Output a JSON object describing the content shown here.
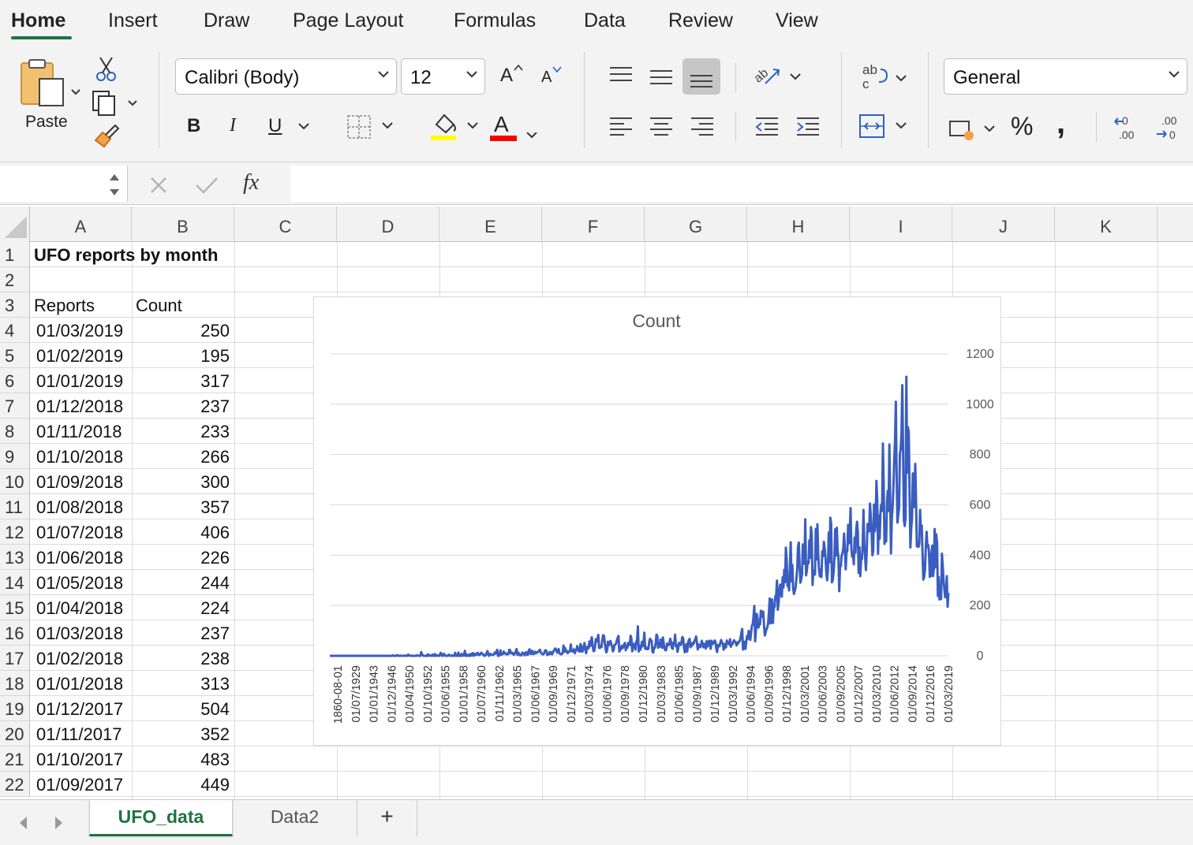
{
  "ribbon_tabs": [
    "Home",
    "Insert",
    "Draw",
    "Page Layout",
    "Formulas",
    "Data",
    "Review",
    "View"
  ],
  "active_tab": "Home",
  "ribbon": {
    "paste_label": "Paste",
    "font_name": "Calibri (Body)",
    "font_size": "12",
    "bold_label": "B",
    "italic_label": "I",
    "underline_label": "U",
    "font_color_label": "A",
    "number_format": "General",
    "percent_label": "%",
    "comma_label": ",",
    "increase_font_label": "A",
    "decrease_font_label": "A",
    "fill_color": "#ffff00",
    "font_color": "#ff0000"
  },
  "formula_bar": {
    "fx_label": "fx",
    "name_box": "",
    "formula": ""
  },
  "columns": [
    "A",
    "B",
    "C",
    "D",
    "E",
    "F",
    "G",
    "H",
    "I",
    "J",
    "K"
  ],
  "rows": [
    "1",
    "2",
    "3",
    "4",
    "5",
    "6",
    "7",
    "8",
    "9",
    "10",
    "11",
    "12",
    "13",
    "14",
    "15",
    "16",
    "17",
    "18",
    "19",
    "20",
    "21",
    "22"
  ],
  "sheet": {
    "title": "UFO reports by month",
    "header_reports": "Reports",
    "header_count": "Count",
    "data": [
      {
        "date": "01/03/2019",
        "count": "250"
      },
      {
        "date": "01/02/2019",
        "count": "195"
      },
      {
        "date": "01/01/2019",
        "count": "317"
      },
      {
        "date": "01/12/2018",
        "count": "237"
      },
      {
        "date": "01/11/2018",
        "count": "233"
      },
      {
        "date": "01/10/2018",
        "count": "266"
      },
      {
        "date": "01/09/2018",
        "count": "300"
      },
      {
        "date": "01/08/2018",
        "count": "357"
      },
      {
        "date": "01/07/2018",
        "count": "406"
      },
      {
        "date": "01/06/2018",
        "count": "226"
      },
      {
        "date": "01/05/2018",
        "count": "244"
      },
      {
        "date": "01/04/2018",
        "count": "224"
      },
      {
        "date": "01/03/2018",
        "count": "237"
      },
      {
        "date": "01/02/2018",
        "count": "238"
      },
      {
        "date": "01/01/2018",
        "count": "313"
      },
      {
        "date": "01/12/2017",
        "count": "504"
      },
      {
        "date": "01/11/2017",
        "count": "352"
      },
      {
        "date": "01/10/2017",
        "count": "483"
      },
      {
        "date": "01/09/2017",
        "count": "449"
      }
    ]
  },
  "chart_data": {
    "type": "line",
    "title": "Count",
    "xlabel": "",
    "ylabel": "",
    "ylim": [
      0,
      1200
    ],
    "yticks": [
      0,
      200,
      400,
      600,
      800,
      1000,
      1200
    ],
    "y_axis_side": "right",
    "grid": true,
    "legend": "none",
    "series_color": "#3a5dbf",
    "x_tick_labels": [
      "1860-08-01",
      "01/07/1929",
      "01/01/1943",
      "01/12/1946",
      "01/04/1950",
      "01/10/1952",
      "01/06/1955",
      "01/01/1958",
      "01/07/1960",
      "01/11/1962",
      "01/03/1965",
      "01/06/1967",
      "01/09/1969",
      "01/12/1971",
      "01/03/1974",
      "01/06/1976",
      "01/09/1978",
      "01/12/1980",
      "01/03/1983",
      "01/06/1985",
      "01/09/1987",
      "01/12/1989",
      "01/03/1992",
      "01/06/1994",
      "01/09/1996",
      "01/12/1998",
      "01/03/2001",
      "01/06/2003",
      "01/09/2005",
      "01/12/2007",
      "01/03/2010",
      "01/06/2012",
      "01/09/2014",
      "01/12/2016",
      "01/03/2019"
    ],
    "series": [
      {
        "values": [
          0,
          0,
          0,
          0,
          0,
          0,
          0,
          0,
          0,
          0,
          0,
          0,
          0,
          0,
          0,
          0,
          0,
          0,
          0,
          0,
          0,
          0,
          0,
          0,
          0,
          0,
          0,
          0,
          0,
          0,
          0,
          0,
          0,
          0,
          0,
          0,
          0,
          0,
          0,
          0,
          0,
          0,
          0,
          0,
          0,
          0,
          0,
          0,
          0,
          0,
          0,
          0,
          0,
          0,
          0,
          0,
          0,
          0,
          0,
          0,
          0,
          0,
          0,
          0,
          0,
          0,
          0,
          0,
          0,
          0,
          0,
          0,
          0,
          0,
          0,
          0,
          0,
          0,
          2,
          0,
          0,
          0,
          0,
          3,
          1,
          0,
          0,
          1,
          0,
          0,
          0,
          0,
          0,
          1,
          0,
          1,
          0,
          5,
          2,
          0,
          0,
          1,
          0,
          0,
          0,
          0,
          0,
          0,
          2,
          1,
          0,
          0,
          0,
          15,
          7,
          2,
          0,
          0,
          0,
          0,
          0,
          6,
          0,
          3,
          2,
          0,
          0,
          5,
          0,
          0,
          7,
          0,
          2,
          0,
          2,
          0,
          0,
          12,
          8,
          0,
          0,
          8,
          4,
          0,
          0,
          0,
          0,
          5,
          2,
          0,
          0,
          2,
          0,
          0,
          0,
          12,
          0,
          0,
          0,
          13,
          0,
          0,
          0,
          8,
          0,
          4,
          2,
          20,
          0,
          6,
          0,
          3,
          0,
          6,
          0,
          8,
          2,
          11,
          0,
          8,
          7,
          3,
          9,
          12,
          4,
          3,
          6,
          12,
          11,
          6,
          5,
          0,
          3,
          2,
          12,
          19,
          6,
          0,
          8,
          6,
          4,
          4,
          3,
          6,
          13,
          9,
          16,
          24,
          0,
          0,
          3,
          22,
          4,
          9,
          7,
          17,
          12,
          9,
          6,
          9,
          6,
          8,
          24,
          23,
          10,
          10,
          12,
          5,
          5,
          10,
          19,
          27,
          4,
          13,
          9,
          2,
          3,
          2,
          13,
          11,
          9,
          2,
          13,
          14,
          4,
          4,
          21,
          26,
          9,
          7,
          20,
          18,
          7,
          9,
          16,
          10,
          14,
          14,
          17,
          22,
          24,
          12,
          10,
          6,
          6,
          9,
          21,
          22,
          19,
          3,
          8,
          6,
          15,
          8,
          14,
          6,
          14,
          20,
          26,
          29,
          24,
          13,
          16,
          27,
          9,
          8,
          6,
          7,
          12,
          41,
          16,
          31,
          17,
          20,
          11,
          13,
          18,
          18,
          45,
          18,
          18,
          17,
          26,
          10,
          23,
          22,
          39,
          24,
          18,
          17,
          47,
          39,
          16,
          21,
          37,
          51,
          29,
          10,
          32,
          37,
          30,
          57,
          39,
          56,
          74,
          41,
          19,
          19,
          38,
          66,
          57,
          68,
          83,
          32,
          31,
          38,
          35,
          62,
          82,
          80,
          57,
          28,
          14,
          22,
          56,
          41,
          50,
          59,
          48,
          38,
          18,
          23,
          43,
          44,
          49,
          61,
          71,
          79,
          17,
          23,
          27,
          40,
          30,
          37,
          46,
          51,
          22,
          38,
          32,
          51,
          52,
          43,
          80,
          68,
          18,
          45,
          48,
          39,
          24,
          54,
          64,
          117,
          17,
          40,
          24,
          35,
          56,
          38,
          53,
          92,
          28,
          35,
          27,
          26,
          28,
          55,
          68,
          63,
          59,
          16,
          13,
          33,
          32,
          51,
          84,
          79,
          32,
          36,
          40,
          65,
          35,
          32,
          73,
          47,
          29,
          22,
          23,
          49,
          44,
          42,
          49,
          68,
          54,
          32,
          28,
          53,
          47,
          84,
          38,
          43,
          16,
          32,
          52,
          45,
          43,
          56,
          75,
          70,
          33,
          14,
          32,
          46,
          17,
          51,
          63,
          67,
          34,
          50,
          40,
          51,
          48,
          60,
          65,
          77,
          52,
          25,
          46,
          41,
          34,
          40,
          60,
          48,
          34,
          48,
          36,
          29,
          58,
          37,
          48,
          60,
          44,
          28,
          60,
          46,
          48,
          55,
          61,
          55,
          28,
          15,
          43,
          40,
          38,
          53,
          63,
          51,
          50,
          24,
          47,
          32,
          34,
          61,
          49,
          54,
          45,
          66,
          36,
          46,
          46,
          56,
          62,
          55,
          54,
          41,
          53,
          49,
          57,
          59,
          73,
          92,
          107,
          25,
          43,
          56,
          27,
          55,
          79,
          67,
          99,
          79,
          63,
          92,
          120,
          125,
          156,
          198,
          58,
          104,
          167,
          148,
          112,
          123,
          125,
          179,
          177,
          155,
          176,
          120,
          81,
          94,
          106,
          113,
          127,
          171,
          228,
          129,
          136,
          224,
          131,
          196,
          193,
          237,
          240,
          299,
          183,
          208,
          262,
          283,
          244,
          235,
          312,
          271,
          342,
          293,
          430,
          384,
          278,
          288,
          260,
          360,
          451,
          296,
          361,
          267,
          246,
          258,
          271,
          305,
          344,
          433,
          450,
          358,
          291,
          305,
          325,
          443,
          420,
          366,
          543,
          320,
          340,
          374,
          368,
          459,
          390,
          512,
          482,
          282,
          339,
          333,
          323,
          504,
          383,
          523,
          403,
          344,
          316,
          344,
          313,
          415,
          396,
          453,
          427,
          392,
          333,
          300,
          342,
          490,
          372,
          549,
          523,
          292,
          301,
          331,
          385,
          503,
          398,
          509,
          418,
          395,
          257,
          354,
          356,
          400,
          409,
          426,
          486,
          424,
          344,
          413,
          416,
          521,
          447,
          483,
          587,
          429,
          394,
          409,
          364,
          470,
          410,
          500,
          533,
          493,
          330,
          432,
          317,
          379,
          384,
          441,
          580,
          442,
          393,
          341,
          418,
          524,
          509,
          494,
          605,
          558,
          496,
          400,
          416,
          601,
          495,
          528,
          695,
          617,
          406,
          557,
          465,
          570,
          602,
          576,
          844,
          674,
          445,
          529,
          455,
          606,
          656,
          576,
          840,
          628,
          407,
          544,
          592,
          667,
          779,
          855,
          1010,
          714,
          530,
          563,
          587,
          802,
          822,
          888,
          1076,
          803,
          539,
          516,
          546,
          1109,
          728,
          909,
          885,
          641,
          431,
          507,
          544,
          725,
          591,
          592,
          763,
          614,
          435,
          453,
          433,
          445,
          580,
          487,
          518,
          409,
          303,
          313,
          339,
          427,
          493,
          435,
          441,
          413,
          314,
          317,
          403,
          438,
          317,
          346,
          504,
          352,
          483,
          449,
          238,
          313,
          224,
          244,
          226,
          406,
          357,
          300,
          266,
          233,
          237,
          317,
          195,
          250
        ]
      }
    ]
  },
  "sheet_tabs": [
    "UFO_data",
    "Data2"
  ],
  "active_sheet": "UFO_data",
  "add_sheet_label": "+"
}
